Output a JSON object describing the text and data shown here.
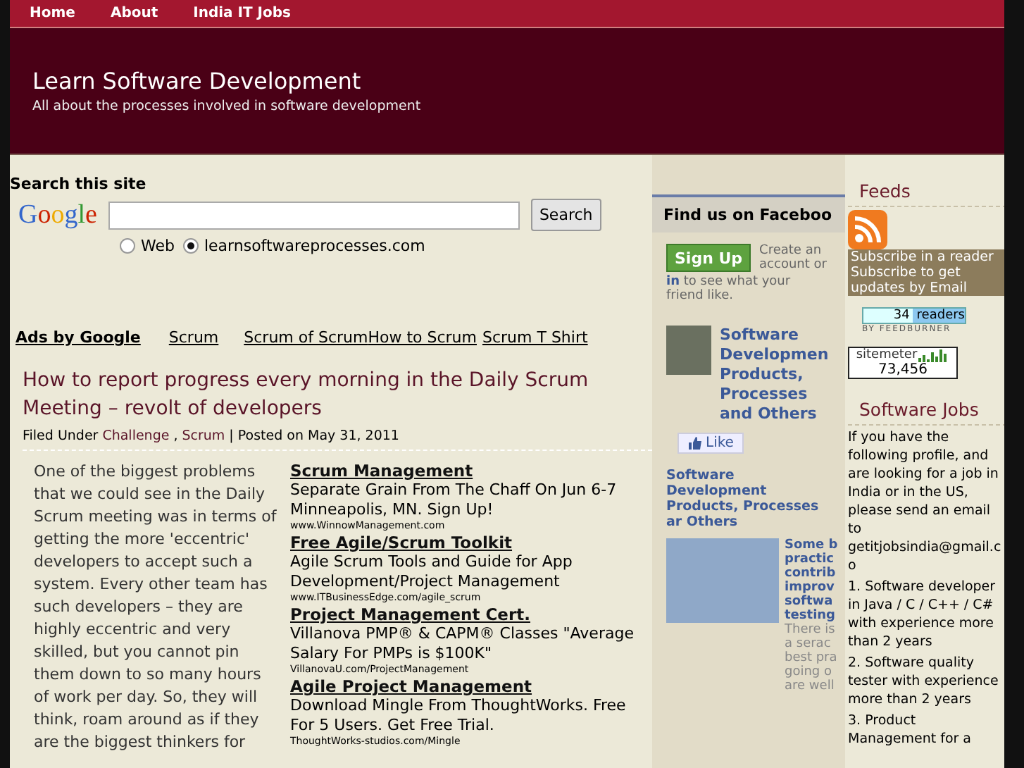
{
  "nav": [
    {
      "label": "Home"
    },
    {
      "label": "About"
    },
    {
      "label": "India IT Jobs"
    }
  ],
  "header": {
    "title": "Learn Software Development",
    "tagline": "All about the processes involved in software development"
  },
  "search": {
    "heading": "Search this site",
    "logo": "Google",
    "button": "Search",
    "options": [
      {
        "label": "Web",
        "selected": false
      },
      {
        "label": "learnsoftwareprocesses.com",
        "selected": true
      }
    ]
  },
  "ads_bar": {
    "label": "Ads by Google",
    "links": [
      "Scrum",
      "Scrum of Scrum",
      "How to Scrum",
      "Scrum T Shirt"
    ]
  },
  "post": {
    "title": "How to report progress every morning in the Daily Scrum Meeting – revolt of developers",
    "filed_under": "Filed Under",
    "categories": [
      "Challenge",
      "Scrum"
    ],
    "separator": ",",
    "posted": "| Posted on May 31, 2011",
    "body": "One of the biggest problems that we could see in the Daily Scrum meeting was in terms of getting the more 'eccentric' developers to accept such a system. Every other team has such developers – they are highly eccentric and very skilled, but you cannot pin them down to so many hours of work per day. So, they will think, roam around as if they are the biggest thinkers for",
    "ads": [
      {
        "title": "Scrum Management",
        "text": "Separate Grain From The Chaff On Jun 6-7 Minneapolis, MN. Sign Up!",
        "url": "www.WinnowManagement.com"
      },
      {
        "title": "Free Agile/Scrum Toolkit",
        "text": "Agile Scrum Tools and Guide for App Development/Project Management",
        "url": "www.ITBusinessEdge.com/agile_scrum"
      },
      {
        "title": "Project Management Cert.",
        "text": "Villanova PMP® & CAPM® Classes \"Average Salary For PMPs is $100K\"",
        "url": "VillanovaU.com/ProjectManagement"
      },
      {
        "title": "Agile Project Management",
        "text": "Download Mingle From ThoughtWorks. Free For 5 Users. Get Free Trial.",
        "url": "ThoughtWorks-studios.com/Mingle"
      }
    ]
  },
  "facebook": {
    "heading": "Find us on Faceboo",
    "signup": "Sign Up",
    "signup_text": "Create an account or",
    "login": "in",
    "login_text": "to see what your friend like.",
    "page_name": "Software Developmen Products, Processes and Others",
    "like": "Like",
    "stream_title": "Software Development Products, Processes ar Others",
    "stream_post_title": "Some b practic contrib improv softwa testing",
    "stream_post_text": "There is a serac best pra going o are well"
  },
  "feeds": {
    "heading": "Feeds",
    "reader": "Subscribe in a reader",
    "email": "Subscribe to get updates by Email",
    "count": "34",
    "count_label": "readers",
    "by": "BY FEEDBURNER",
    "sitemeter": "sitemeter",
    "visits": "73,456"
  },
  "jobs": {
    "heading": "Software Jobs",
    "intro": "If you have the following profile, and are looking for a job in India or in the US, please send an email to getitjobsindia@gmail.co",
    "items": [
      "1. Software developer in Java / C / C++ / C# with experience more than 2 years",
      "2. Software quality tester with experience more than 2 years",
      "3. Product Management for a"
    ]
  }
}
